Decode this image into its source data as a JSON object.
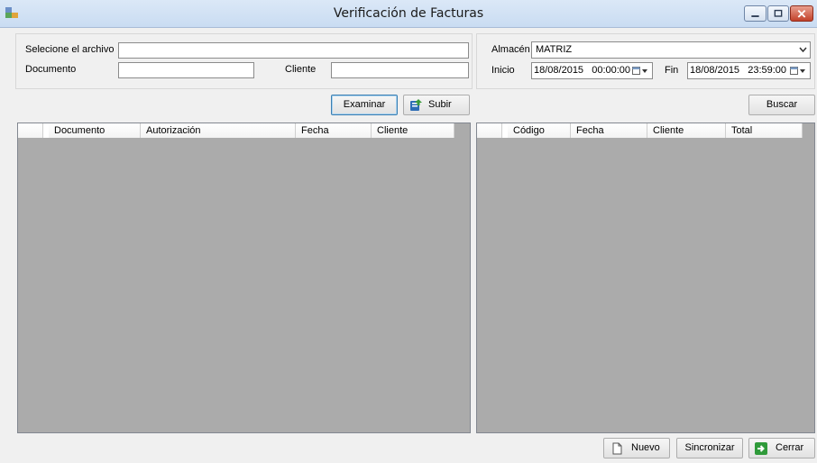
{
  "window": {
    "title": "Verificación de Facturas"
  },
  "upload": {
    "file_label": "Selecione el archivo",
    "file_value": "",
    "document_label": "Documento",
    "document_value": "",
    "client_label": "Cliente",
    "client_value": "",
    "browse_button": "Examinar",
    "upload_button": "Subir"
  },
  "search": {
    "warehouse_label": "Almacén",
    "warehouse_value": "MATRIZ",
    "start_label": "Inicio",
    "start_value": "18/08/2015   00:00:00",
    "end_label": "Fin",
    "end_value": "18/08/2015   23:59:00",
    "search_button": "Buscar"
  },
  "left_grid": {
    "columns": [
      "Documento",
      "Autorización",
      "Fecha",
      "Cliente"
    ],
    "rows": []
  },
  "right_grid": {
    "columns": [
      "Código",
      "Fecha",
      "Cliente",
      "Total"
    ],
    "rows": []
  },
  "footer": {
    "new_button": "Nuevo",
    "sync_button": "Sincronizar",
    "close_button": "Cerrar"
  },
  "colors": {
    "grid_background": "#ababab",
    "titlebar": "#dbe8f7",
    "close_red": "#c2412a"
  }
}
